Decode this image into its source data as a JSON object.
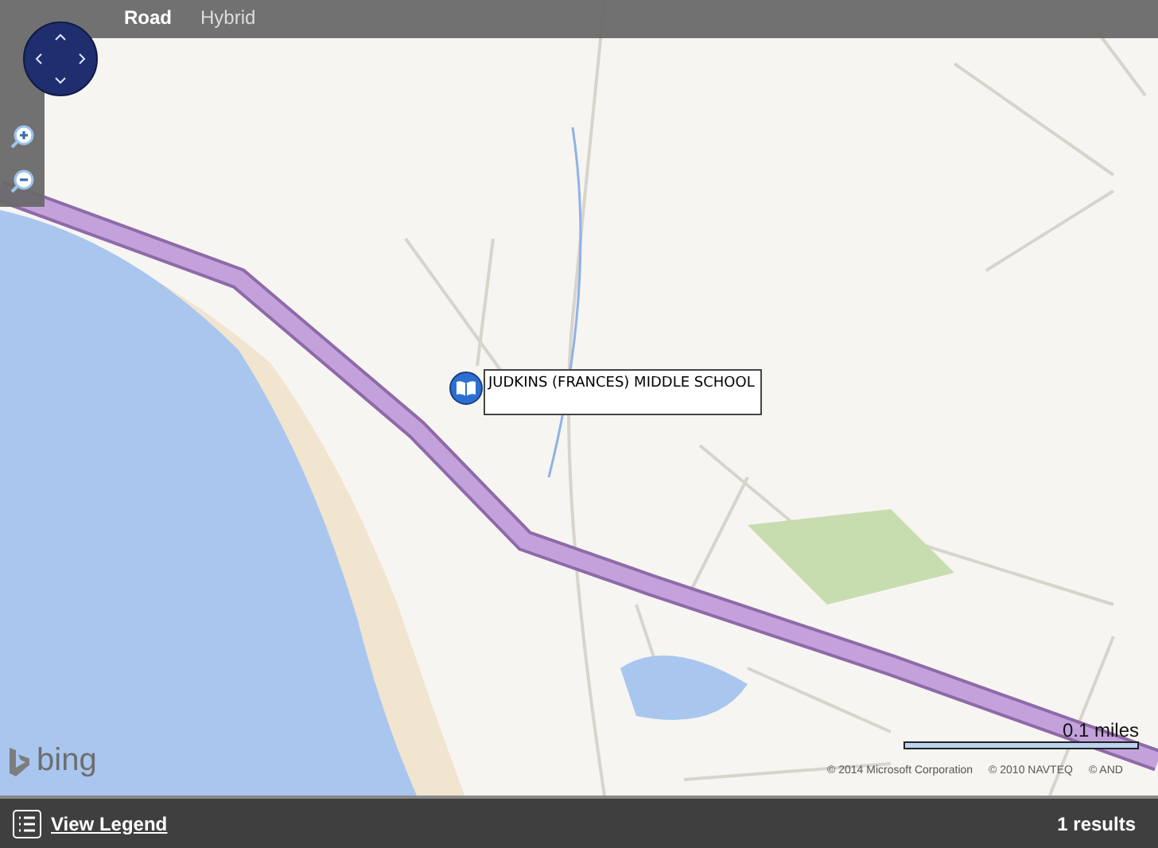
{
  "map_tabs": [
    {
      "label": "Road",
      "selected": true
    },
    {
      "label": "Hybrid",
      "selected": false
    }
  ],
  "map_popup": {
    "text": "JUDKINS (FRANCES) MIDDLE SCHOOL"
  },
  "scale": {
    "text": "0.1 miles"
  },
  "copyright": [
    "© 2014 Microsoft Corporation",
    "© 2010 NAVTEQ",
    "© AND"
  ],
  "map_logo": {
    "text": "bing"
  },
  "footer": {
    "legend_link": "View Legend",
    "results": "1 results"
  }
}
